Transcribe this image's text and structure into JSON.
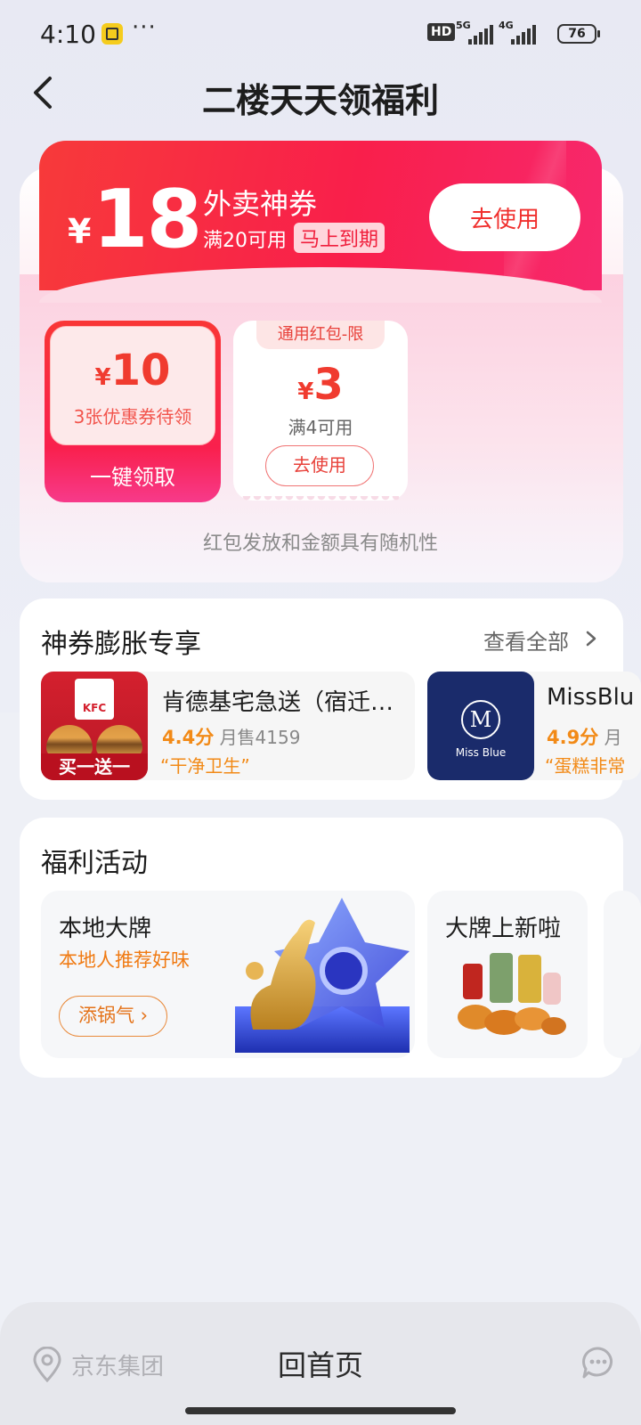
{
  "status": {
    "time": "4:10",
    "menu": "···",
    "hd": "HD",
    "net1": "5G",
    "net2": "4G",
    "battery": "76"
  },
  "header": {
    "title": "二楼天天领福利"
  },
  "coupon": {
    "currency": "¥",
    "amount": "18",
    "title": "外卖神券",
    "condition": "满20可用",
    "expire": "马上到期",
    "use_button": "去使用"
  },
  "claim": {
    "currency": "¥",
    "amount": "10",
    "sub": "3张优惠券待领",
    "button": "一键领取"
  },
  "ticket": {
    "tag": "通用红包-限",
    "currency": "¥",
    "amount": "3",
    "sub": "满4可用",
    "button": "去使用"
  },
  "disclaimer": "红包发放和金额具有随机性",
  "section_inflate": {
    "title": "神券膨胀专享",
    "view_all": "查看全部",
    "stores": [
      {
        "name": "肯德基宅急送（宿迁…",
        "rating": "4.4分",
        "sales": "月售4159",
        "quote": "“干净卫生”",
        "badge": "买一送一"
      },
      {
        "name": "MissBlu",
        "rating": "4.9分",
        "sales": "月",
        "quote": "“蛋糕非常",
        "logo_text": "Miss Blue"
      }
    ]
  },
  "section_welfare": {
    "title": "福利活动",
    "activities": [
      {
        "title": "本地大牌",
        "subtitle": "本地人推荐好味",
        "button": "添锅气"
      },
      {
        "title": "大牌上新啦"
      }
    ]
  },
  "bottom": {
    "location": "京东集团",
    "home": "回首页"
  },
  "colors": {
    "accent_red": "#f91f4b",
    "orange": "#f28a17"
  }
}
